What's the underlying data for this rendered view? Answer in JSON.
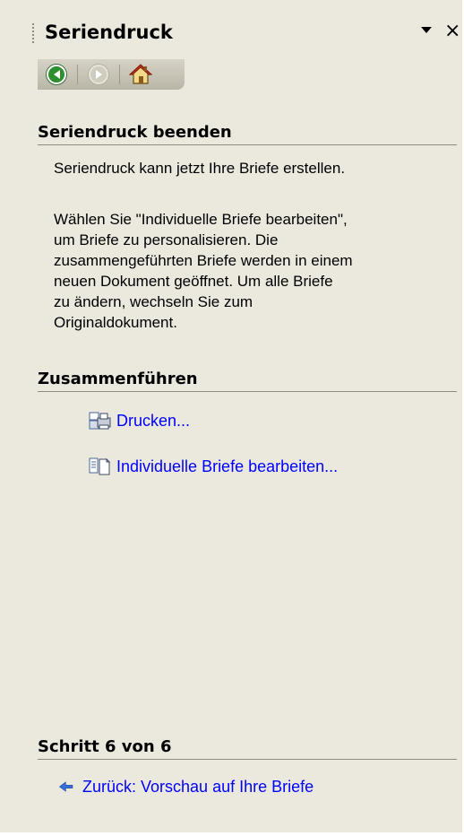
{
  "panel": {
    "title": "Seriendruck",
    "dropdown_icon": "dropdown-arrow-icon",
    "close_label": "×"
  },
  "nav": {
    "back_icon": "back-arrow-icon",
    "forward_icon": "forward-arrow-icon",
    "home_icon": "home-icon"
  },
  "sections": {
    "finish": {
      "header": "Seriendruck beenden",
      "paragraph1": "Seriendruck kann jetzt Ihre Briefe erstellen.",
      "paragraph2_lines": [
        "Wählen Sie \"Individuelle Briefe bearbeiten\",",
        "um Briefe zu personalisieren. Die",
        "zusammengeführten Briefe werden in einem",
        "neuen Dokument geöffnet. Um alle Briefe",
        "zu ändern, wechseln Sie zum",
        "Originaldokument."
      ]
    },
    "merge": {
      "header": "Zusammenführen",
      "print_label": "Drucken...",
      "edit_label": "Individuelle Briefe bearbeiten..."
    },
    "step": {
      "header": "Schritt 6 von 6",
      "back_label": "Zurück: Vorschau auf Ihre Briefe"
    }
  },
  "colors": {
    "panel_bg": "#ebe9de",
    "link": "#0000ff",
    "back_button": "#2e8f2e",
    "home_roof": "#c0311b"
  }
}
